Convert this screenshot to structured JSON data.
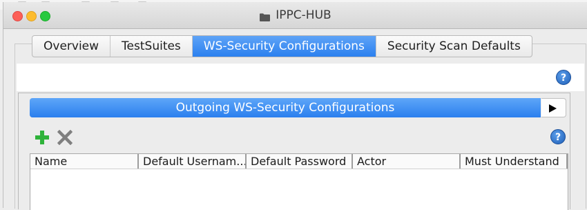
{
  "window": {
    "title": "IPPC-HUB",
    "title_icon": "folder-icon"
  },
  "tabs": [
    {
      "label": "Overview",
      "active": false
    },
    {
      "label": "TestSuites",
      "active": false
    },
    {
      "label": "WS-Security Configurations",
      "active": true
    },
    {
      "label": "Security Scan Defaults",
      "active": false
    }
  ],
  "section": {
    "header": "Outgoing WS-Security Configurations",
    "toolbar": {
      "add_icon": "plus-icon",
      "remove_icon": "x-icon",
      "help_icon": "help-icon"
    }
  },
  "help_label": "?",
  "table": {
    "columns": [
      "Name",
      "Default Usernam...",
      "Default Password",
      "Actor",
      "Must Understand"
    ],
    "rows": []
  },
  "colors": {
    "accent": "#2b80ef",
    "add_green": "#2fb33a",
    "remove_gray": "#7f7f7f"
  }
}
